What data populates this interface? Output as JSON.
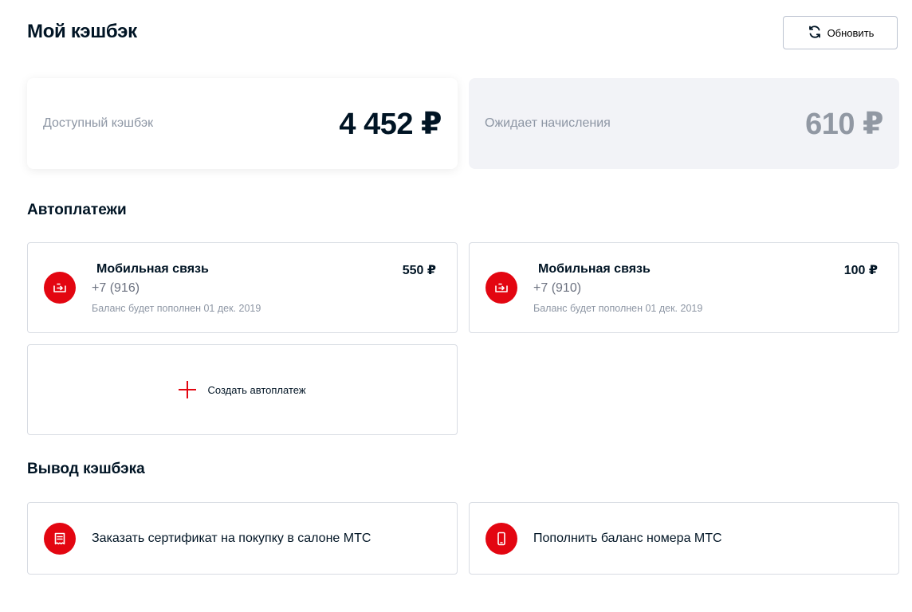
{
  "header": {
    "title": "Мой кэшбэк",
    "refresh_label": "Обновить",
    "refresh_icon": "refresh-icon"
  },
  "balances": {
    "available": {
      "label": "Доступный кэшбэк",
      "amount": "4 452 ₽"
    },
    "pending": {
      "label": "Ожидает начисления",
      "amount": "610 ₽"
    }
  },
  "autopay": {
    "section_title": "Автоплатежи",
    "items": [
      {
        "service": "Мобильная связь",
        "amount": "550 ₽",
        "phone": "+7 (916)",
        "date": "Баланс будет пополнен 01 дек. 2019",
        "icon": "autopay-icon"
      },
      {
        "service": "Мобильная связь",
        "amount": "100 ₽",
        "phone": "+7 (910)",
        "date": "Баланс будет пополнен 01 дек. 2019",
        "icon": "autopay-icon"
      }
    ],
    "create_label": "Создать автоплатеж"
  },
  "withdraw": {
    "section_title": "Вывод кэшбэка",
    "items": [
      {
        "label": "Заказать сертификат на покупку в салоне МТС",
        "icon": "certificate-icon"
      },
      {
        "label": "Пополнить баланс номера МТС",
        "icon": "phone-icon"
      }
    ]
  },
  "colors": {
    "accent": "#e30611",
    "text": "#001424",
    "muted": "#8d96a4",
    "pending_bg": "#f2f3f7"
  }
}
